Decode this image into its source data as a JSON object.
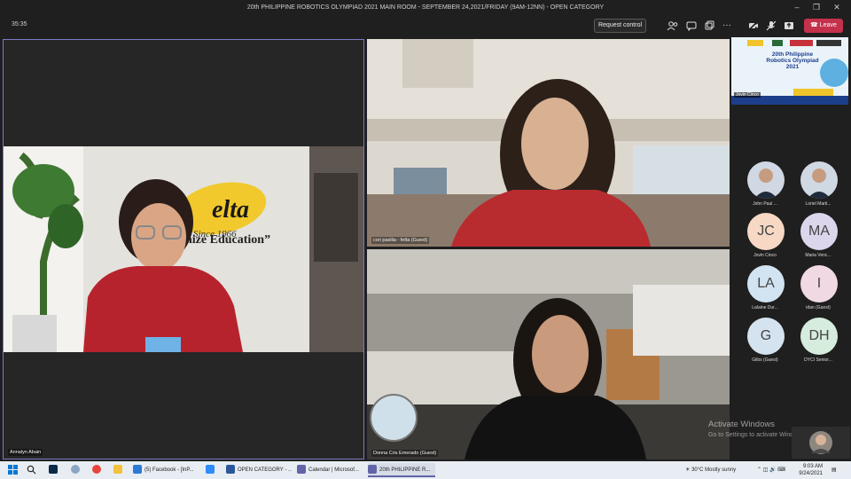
{
  "window": {
    "title": "20th PHILIPPINE ROBOTICS OLYMPIAD 2021 MAIN ROOM - SEPTEMBER 24,2021/FRIDAY (9AM-12NN) - OPEN CATEGORY"
  },
  "toolbar": {
    "timer": "35:35",
    "request_control": "Request control",
    "leave": "Leave",
    "icons": [
      "people-icon",
      "chat-icon",
      "reactions-icon",
      "more-icon",
      "camera-off-icon",
      "mic-off-icon",
      "share-icon"
    ]
  },
  "tiles": [
    {
      "name": "Annalyn Abain"
    },
    {
      "name": "cori pasilia - felta (Guest)"
    },
    {
      "name": "Donna Cris Emerado (Guest)"
    }
  ],
  "poster": {
    "title": "20th Philippine Robotics Olympiad 2021",
    "presenter": "Jovin Cinco"
  },
  "participants": [
    {
      "initials": "",
      "label": "John Paul ...",
      "color": "#cfd8e3"
    },
    {
      "initials": "",
      "label": "Loriel Marti...",
      "color": "#cfd8e3"
    },
    {
      "initials": "JC",
      "label": "Jovin Cinco",
      "color": "#f6d8c4"
    },
    {
      "initials": "MA",
      "label": "Maria Venc...",
      "color": "#dcd6ec"
    },
    {
      "initials": "LA",
      "label": "Lalaine Dur...",
      "color": "#d2e4f1"
    },
    {
      "initials": "I",
      "label": "idan (Guest)",
      "color": "#f1d9e4"
    },
    {
      "initials": "G",
      "label": "Gilbs (Guest)",
      "color": "#d5e3f0"
    },
    {
      "initials": "DH",
      "label": "DYCI Senior...",
      "color": "#d6ecdc"
    }
  ],
  "watermark": {
    "line1": "Activate Windows",
    "line2": "Go to Settings to activate Windows."
  },
  "taskbar": {
    "apps": [
      {
        "label": "(5) Facebook - [InP...",
        "color": "#2d7ad6"
      },
      {
        "label": "",
        "color": "#2d8cff"
      },
      {
        "label": "OPEN CATEGORY - ...",
        "color": "#2b579a"
      },
      {
        "label": "Calendar | Microsof...",
        "color": "#6264a7"
      },
      {
        "label": "20th PHILIPPINE R...",
        "color": "#6264a7"
      }
    ],
    "weather": "30°C  Mostly sunny",
    "time": "9:03 AM",
    "date": "9/24/2021"
  },
  "colors": {
    "accent": "#6264a7",
    "leave": "#c4314b"
  }
}
